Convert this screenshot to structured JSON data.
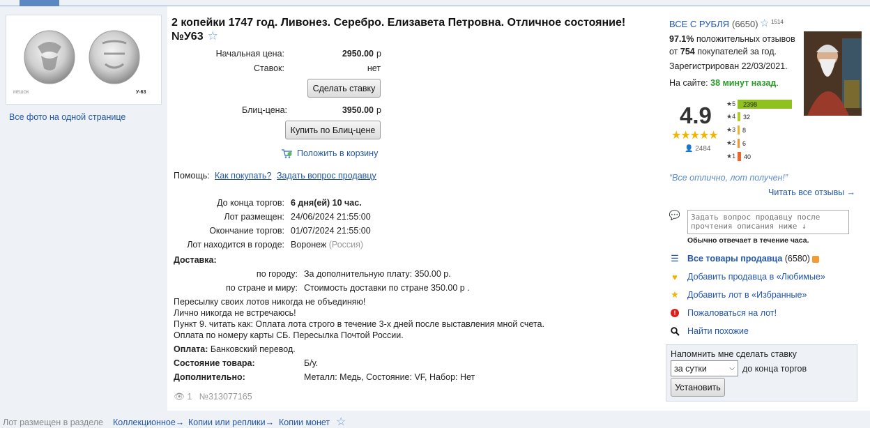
{
  "lot": {
    "title": "2 копейки 1747 год. Ливонез. Серебро. Елизавета Петровна. Отличное состояние! №У63",
    "favorite_icon": "star-outline-icon",
    "photo_label": "У-63",
    "photo_watermark": "МЕШОК",
    "all_photos_link": "Все фото на одной странице"
  },
  "prices": {
    "start_label": "Начальная цена:",
    "start_value": "2950.00",
    "currency": "р",
    "bids_label": "Ставок:",
    "bids_value": "нет",
    "bid_button": "Сделать ставку",
    "blitz_label": "Блиц-цена:",
    "blitz_value": "3950.00",
    "blitz_button": "Купить по Блиц-цене",
    "cart_link": "Положить в корзину"
  },
  "help": {
    "label": "Помощь:",
    "how_to_buy": "Как покупать?",
    "ask_seller": "Задать вопрос продавцу"
  },
  "auction": {
    "ends_in_label": "До конца торгов:",
    "ends_in_value": "6 дня(ей) 10 час.",
    "placed_label": "Лот размещен:",
    "placed_value": "24/06/2024 21:55:00",
    "end_label": "Окончание торгов:",
    "end_value": "01/07/2024 21:55:00",
    "city_label": "Лот находится в городе:",
    "city_value": "Воронеж",
    "country_value": "(Россия)"
  },
  "delivery": {
    "heading": "Доставка:",
    "city_label": "по городу:",
    "city_value": "За дополнительную плату: 350.00 р.",
    "world_label": "по стране и миру:",
    "world_value": "Стоимость доставки по стране 350.00 р .",
    "notes": [
      "Пересылку своих лотов никогда не объединяю!",
      "Лично никогда не встречаюсь!",
      "Пункт 9. читать как: Оплата лота строго в течение 3-х дней после выставления мной счета.",
      "Оплата по номеру карты СБ. Пересылка Почтой России."
    ],
    "payment_label": "Оплата:",
    "payment_value": "Банковский перевод.",
    "condition_label": "Состояние товара:",
    "condition_value": "Б/у.",
    "extra_label": "Дополнительно:",
    "extra_value": "Металл: Медь, Состояние: VF, Набор: Нет"
  },
  "stats": {
    "views": "1",
    "lot_number": "№313077165"
  },
  "seller": {
    "name": "ВСЕ С РУБЛЯ",
    "rating_count": "(6650)",
    "star_badge": "1514",
    "positive_pct": "97.1%",
    "positive_text": "положительных отзывов",
    "from_text": "от",
    "buyers_count": "754",
    "buyers_text": "покупателей за год.",
    "registered": "Зарегистрирован 22/03/2021.",
    "online_label": "На сайте:",
    "online_value": "38 минут назад",
    "score": "4.9",
    "score_users": "2484",
    "ratings": [
      {
        "stars": "5",
        "count": "2398",
        "fraction": 1.0,
        "color": "#8fc21f"
      },
      {
        "stars": "4",
        "count": "32",
        "fraction": 0.05,
        "color": "#b2cc2a"
      },
      {
        "stars": "3",
        "count": "8",
        "fraction": 0.03,
        "color": "#e8b62a"
      },
      {
        "stars": "2",
        "count": "6",
        "fraction": 0.03,
        "color": "#f0962a"
      },
      {
        "stars": "1",
        "count": "40",
        "fraction": 0.06,
        "color": "#e8672a"
      }
    ],
    "quote": "“Все отлично, лот получен!”",
    "all_reviews": "Читать все отзывы →",
    "question_placeholder": "Задать вопрос продавцу после прочтения описания ниже ↓",
    "reply_note": "Обычно отвечает в течение часа.",
    "all_goods": "Все товары продавца",
    "all_goods_count": "(6580)",
    "add_fav_seller": "Добавить продавца в «Любимые»",
    "add_fav_lot": "Добавить лот в «Избранные»",
    "complain": "Пожаловаться на лот!",
    "find_similar": "Найти похожие"
  },
  "reminder": {
    "label": "Напомнить мне сделать ставку",
    "option": "за сутки",
    "suffix": "до конца торгов",
    "button": "Установить"
  },
  "breadcrumb": {
    "label": "Лот размещен в разделе",
    "items": [
      "Коллекционное→",
      "Копии или реплики→",
      "Копии монет"
    ]
  }
}
